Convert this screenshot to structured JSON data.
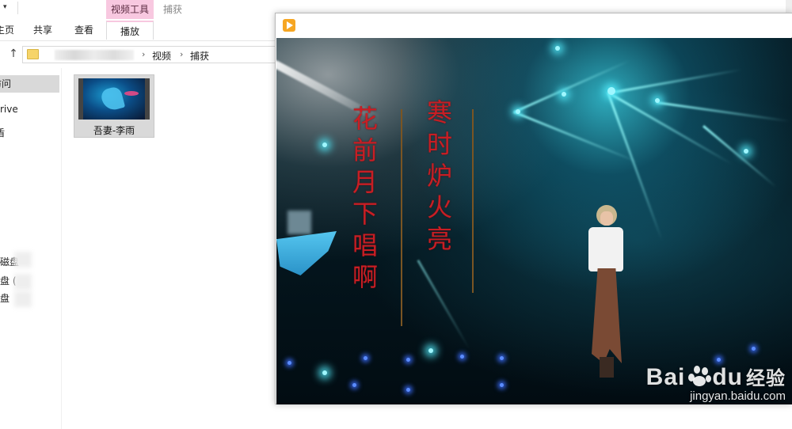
{
  "ribbon": {
    "contextual_tab_group": "视频工具",
    "contextual_tab_group_2": "捕获",
    "tabs": [
      {
        "label": "主页"
      },
      {
        "label": "共享"
      },
      {
        "label": "查看"
      },
      {
        "label": "播放"
      }
    ]
  },
  "address": {
    "crumbs": [
      "视频",
      "捕获"
    ]
  },
  "nav": {
    "items": [
      {
        "label": "访问"
      },
      {
        "label": "rive"
      },
      {
        "label": "盾"
      },
      {
        "label": "磁盘"
      },
      {
        "label": "盘 ("
      },
      {
        "label": "盘"
      }
    ]
  },
  "files": [
    {
      "name": "吾妻-李雨",
      "icon": "video-file-icon"
    }
  ],
  "player": {
    "icon": "media-player-icon",
    "lyrics_left": [
      "花",
      "前",
      "月",
      "下",
      "唱",
      "啊"
    ],
    "lyrics_right": [
      "寒",
      "时",
      "炉",
      "火",
      "亮"
    ],
    "watermark_logo": "Bai",
    "watermark_logo_tail": "du",
    "watermark_cn": "经验",
    "watermark_url": "jingyan.baidu.com"
  },
  "colors": {
    "contextual_tab": "#f8c8e0",
    "selected_nav": "#d9d9d9",
    "lyric_red": "#c81e24",
    "stage_teal": "#3cdcf0"
  }
}
